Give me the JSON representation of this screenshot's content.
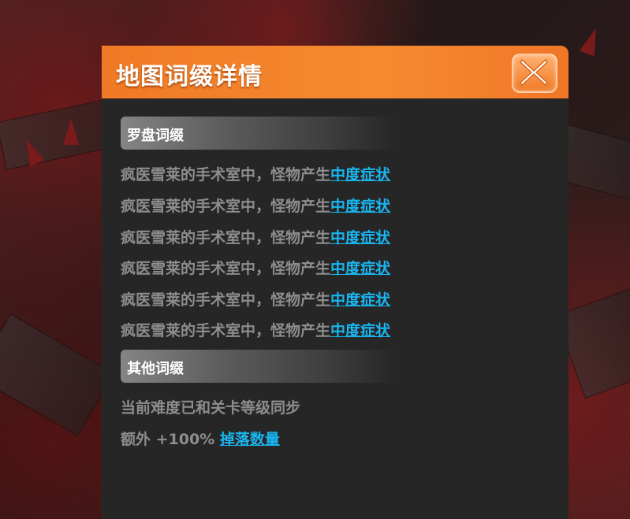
{
  "dialog": {
    "title": "地图词缀详情",
    "close_icon": "close-x-icon"
  },
  "compass_affixes": {
    "header": "罗盘词缀",
    "rows": [
      {
        "text": "疯医雪莱的手术室中，怪物产生",
        "link": "中度症状"
      },
      {
        "text": "疯医雪莱的手术室中，怪物产生",
        "link": "中度症状"
      },
      {
        "text": "疯医雪莱的手术室中，怪物产生",
        "link": "中度症状"
      },
      {
        "text": "疯医雪莱的手术室中，怪物产生",
        "link": "中度症状"
      },
      {
        "text": "疯医雪莱的手术室中，怪物产生",
        "link": "中度症状"
      },
      {
        "text": "疯医雪莱的手术室中，怪物产生",
        "link": "中度症状"
      }
    ]
  },
  "other_affixes": {
    "header": "其他词缀",
    "sync_text": "当前难度已和关卡等级同步",
    "bonus_prefix": "额外 +100% ",
    "bonus_link": "掉落数量"
  },
  "colors": {
    "header_orange": "#f58a30",
    "link_blue": "#19b6f0",
    "text_gray": "#8d8d8d",
    "panel_bg": "#262626"
  }
}
